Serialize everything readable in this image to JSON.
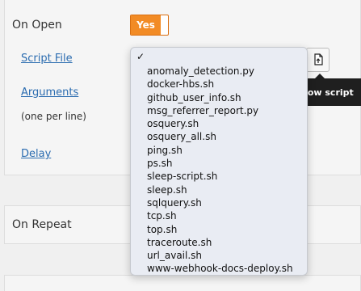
{
  "on_open": {
    "label": "On Open",
    "toggle_label": "Yes",
    "script_file_label": "Script File",
    "arguments_label": "Arguments",
    "arguments_hint": "(one per line)",
    "delay_label": "Delay",
    "show_script_tooltip": "how script"
  },
  "dropdown": {
    "selected_marker": "✓",
    "options": [
      "anomaly_detection.py",
      "docker-hbs.sh",
      "github_user_info.sh",
      "msg_referrer_report.py",
      "osquery.sh",
      "osquery_all.sh",
      "ping.sh",
      "ps.sh",
      "sleep-script.sh",
      "sleep.sh",
      "sqlquery.sh",
      "tcp.sh",
      "top.sh",
      "traceroute.sh",
      "url_avail.sh",
      "www-webhook-docs-deploy.sh"
    ]
  },
  "on_repeat": {
    "label": "On Repeat"
  },
  "colors": {
    "toggle_on": "#f28b25",
    "link": "#2b6cb0",
    "tooltip_bg": "#1f1f1f",
    "dropdown_bg": "#e9ecf3"
  },
  "icons": {
    "show_script": "document-script-icon"
  }
}
